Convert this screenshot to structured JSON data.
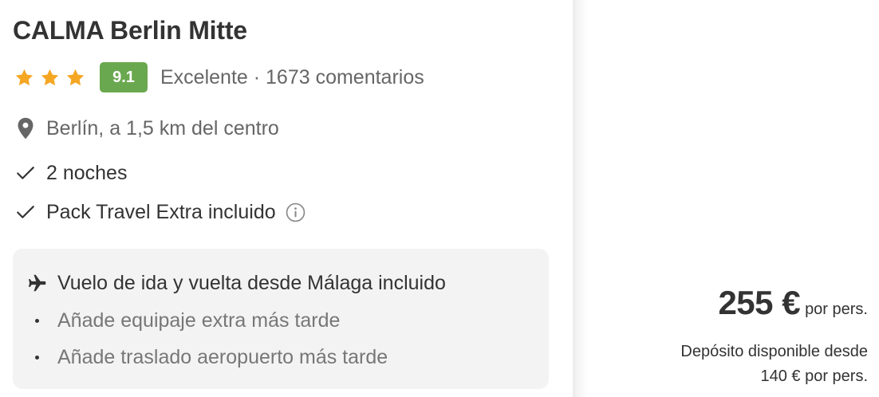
{
  "hotel": {
    "name": "CALMA Berlin Mitte",
    "stars": 3,
    "score": "9.1",
    "rating_text": "Excelente · 1673 comentarios",
    "location_text": "Berlín, a 1,5 km del centro",
    "icons": {
      "star": "star-icon",
      "location": "location-pin-icon",
      "check": "check-icon",
      "info": "info-circle-icon",
      "flight": "airplane-icon"
    },
    "colors": {
      "star": "#f5a623",
      "score_badge": "#6aa84f",
      "flight_box": "#f3f3f3"
    }
  },
  "features": [
    {
      "label": "2 noches"
    },
    {
      "label": "Pack Travel Extra incluido"
    }
  ],
  "flight": {
    "title": "Vuelo de ida y vuelta desde Málaga incluido",
    "items": [
      {
        "label": "Añade equipaje extra más tarde"
      },
      {
        "label": "Añade traslado aeropuerto más tarde"
      }
    ]
  },
  "pricing": {
    "amount": "255 €",
    "unit": "por pers.",
    "deposit_line1": "Depósito disponible desde",
    "deposit_line2": "140 € por pers."
  }
}
